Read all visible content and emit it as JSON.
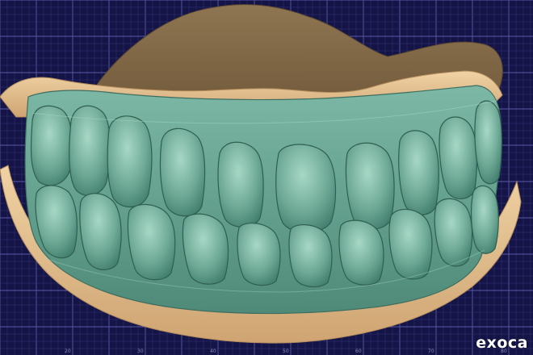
{
  "viewer": {
    "background": "#141446",
    "grid_minor_color": "#34347a",
    "grid_major_color": "#5a5aa8",
    "brand": "exoca"
  },
  "model": {
    "description_colors": {
      "occlusal_rim": "#8a7150",
      "base_cast": "#e6c597",
      "teeth": "#6fab98"
    }
  },
  "scale_labels": [
    "20",
    "30",
    "40",
    "50",
    "60",
    "70",
    "80"
  ]
}
